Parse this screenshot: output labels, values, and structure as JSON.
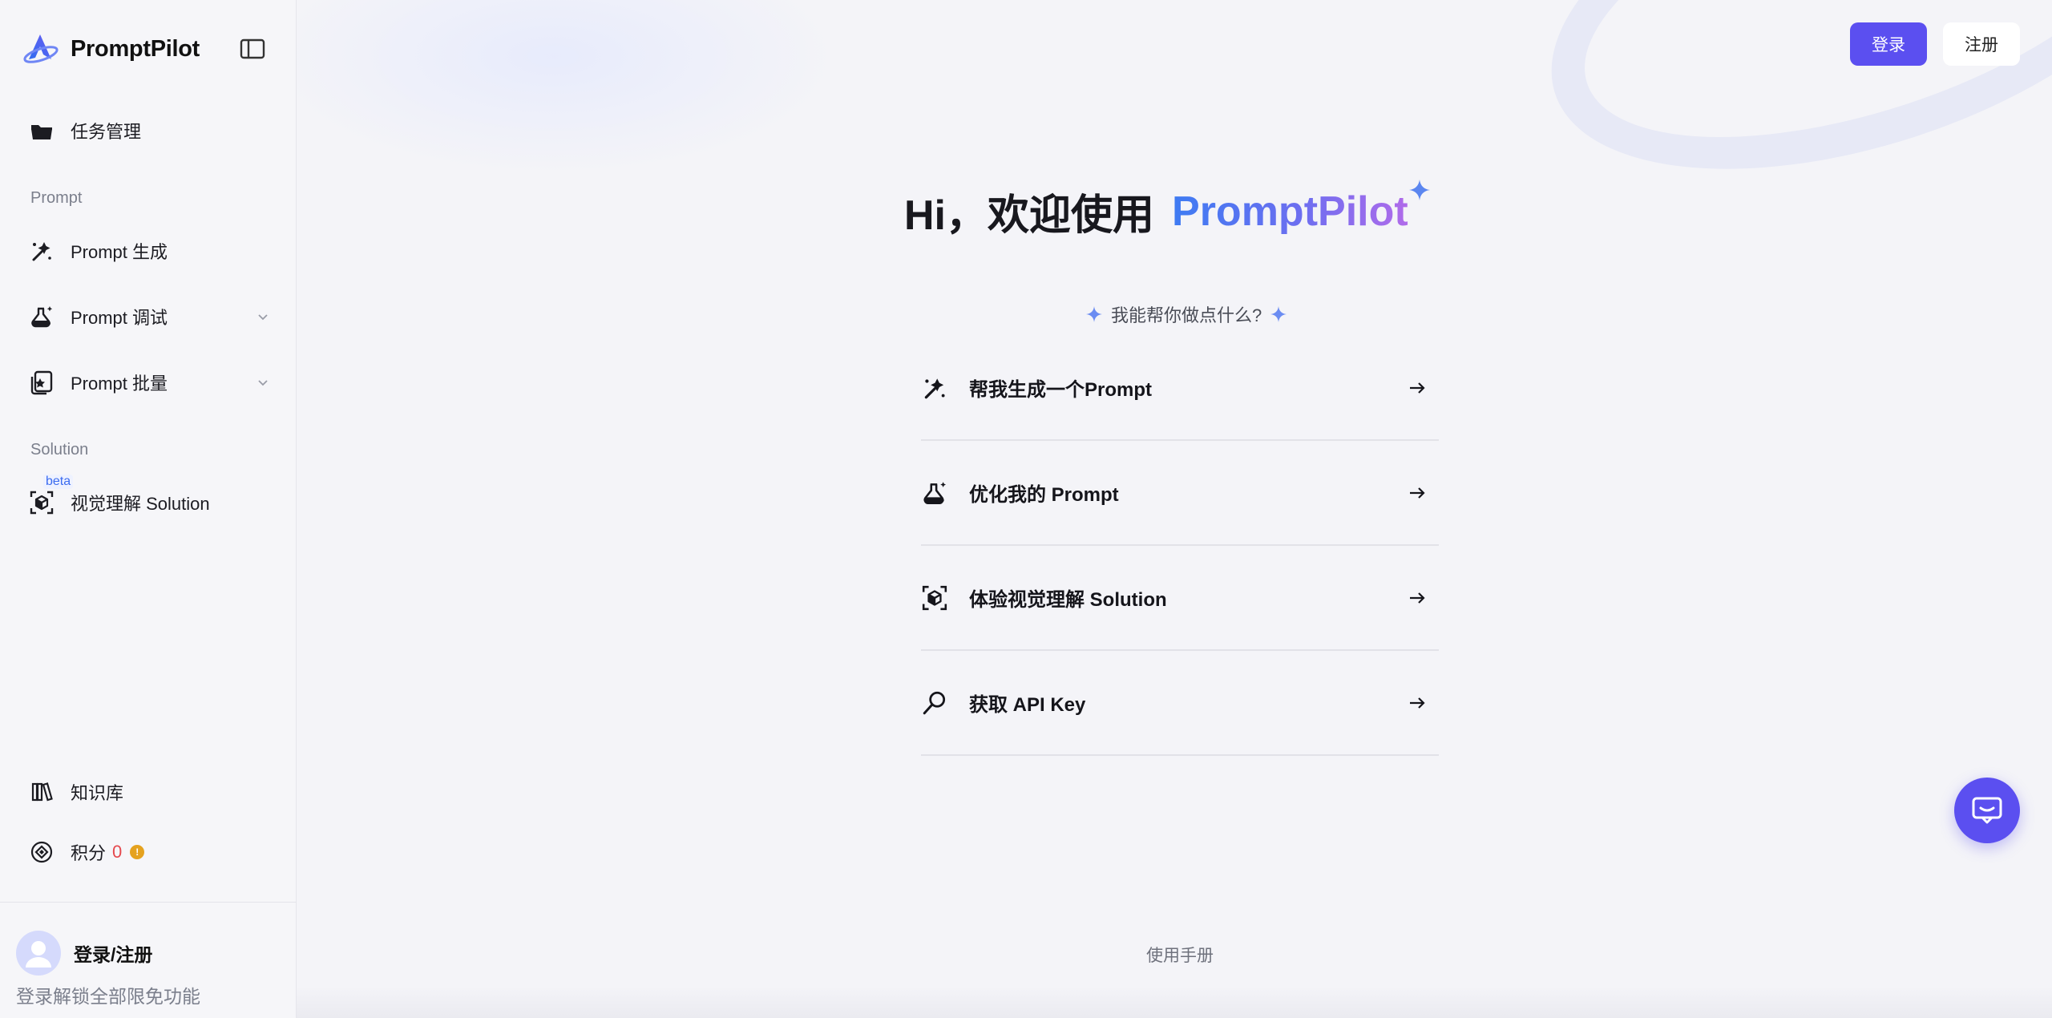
{
  "brand": {
    "name": "PromptPilot"
  },
  "sidebar": {
    "items": [
      {
        "key": "tasks",
        "label": "任务管理",
        "icon": "folder-icon"
      },
      {
        "key": "gen",
        "label": "Prompt 生成",
        "icon": "magic-wand-icon"
      },
      {
        "key": "debug",
        "label": "Prompt 调试",
        "icon": "flask-icon"
      },
      {
        "key": "batch",
        "label": "Prompt 批量",
        "icon": "batch-icon"
      },
      {
        "key": "vision",
        "label": "视觉理解 Solution",
        "icon": "cube-scan-icon",
        "badge": "beta"
      }
    ],
    "sections": {
      "prompt": "Prompt",
      "solution": "Solution"
    },
    "knowledge": {
      "label": "知识库"
    },
    "points": {
      "label": "积分",
      "value": "0"
    },
    "user": {
      "name": "登录/注册",
      "hint": "登录解锁全部限免功能"
    }
  },
  "header": {
    "login_label": "登录",
    "register_label": "注册"
  },
  "hero": {
    "greeting": "Hi，欢迎使用",
    "brand": "PromptPilot",
    "question": "我能帮你做点什么?"
  },
  "actions": [
    {
      "label": "帮我生成一个Prompt",
      "icon": "magic-wand-icon"
    },
    {
      "label": "优化我的 Prompt",
      "icon": "flask-icon"
    },
    {
      "label": "体验视觉理解 Solution",
      "icon": "cube-scan-icon"
    },
    {
      "label": "获取 API Key",
      "icon": "key-icon"
    }
  ],
  "footer": {
    "manual": "使用手册"
  },
  "colors": {
    "accent": "#5b4ff0",
    "brand_gradient_start": "#3e7bf2",
    "brand_gradient_end": "#b06bea",
    "points_value": "#e5484d"
  }
}
